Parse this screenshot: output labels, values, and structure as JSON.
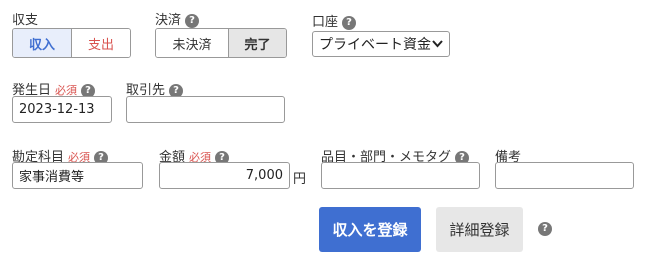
{
  "income_expense": {
    "label": "収支",
    "options": [
      "収入",
      "支出"
    ],
    "selected": "収入"
  },
  "settlement": {
    "label": "決済",
    "options": [
      "未決済",
      "完了"
    ],
    "selected": "完了"
  },
  "account": {
    "label": "口座",
    "value": "プライベート資金"
  },
  "date": {
    "label": "発生日",
    "required": "必須",
    "value": "2023-12-13"
  },
  "partner": {
    "label": "取引先",
    "value": ""
  },
  "category": {
    "label": "勘定科目",
    "required": "必須",
    "value": "家事消費等"
  },
  "amount": {
    "label": "金額",
    "required": "必須",
    "value": "7,000",
    "unit": "円"
  },
  "item": {
    "label": "品目・部門・メモタグ",
    "value": ""
  },
  "notes": {
    "label": "備考",
    "value": ""
  },
  "actions": {
    "register": "収入を登録",
    "detail": "詳細登録"
  },
  "help_glyph": "?",
  "colors": {
    "accent": "#3f6fd1",
    "required": "#d9534f",
    "selected_bg": "#e8eefb"
  }
}
